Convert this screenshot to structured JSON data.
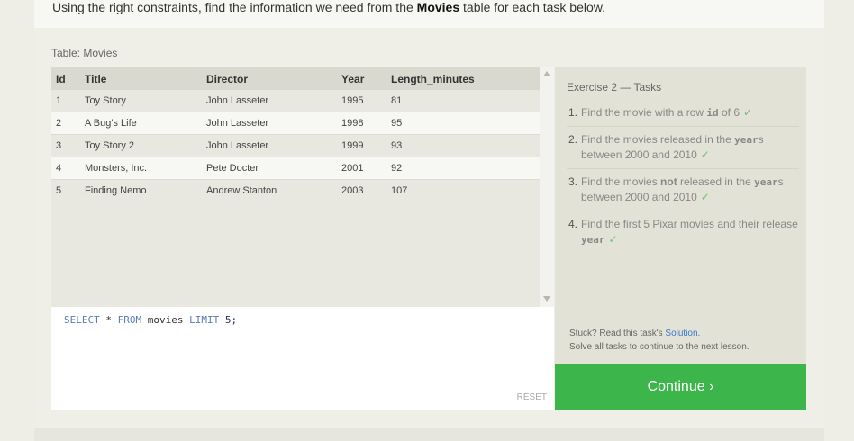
{
  "intro": {
    "before": "Using the right constraints, find the information we need from the ",
    "emphasis": "Movies",
    "after": " table for each task below."
  },
  "table": {
    "caption": "Table: Movies",
    "headers": [
      "Id",
      "Title",
      "Director",
      "Year",
      "Length_minutes"
    ],
    "rows": [
      [
        "1",
        "Toy Story",
        "John Lasseter",
        "1995",
        "81"
      ],
      [
        "2",
        "A Bug's Life",
        "John Lasseter",
        "1998",
        "95"
      ],
      [
        "3",
        "Toy Story 2",
        "John Lasseter",
        "1999",
        "93"
      ],
      [
        "4",
        "Monsters, Inc.",
        "Pete Docter",
        "2001",
        "92"
      ],
      [
        "5",
        "Finding Nemo",
        "Andrew Stanton",
        "2003",
        "107"
      ]
    ]
  },
  "editor": {
    "query_parts": [
      "SELECT",
      "*",
      "FROM",
      "movies",
      "LIMIT",
      "5;"
    ],
    "reset_label": "RESET"
  },
  "tasks": {
    "title": "Exercise 2 — Tasks",
    "items": [
      {
        "num": "1.",
        "text1": "Find the movie with a row ",
        "code": "id",
        "text2": " of 6"
      },
      {
        "num": "2.",
        "text1": "Find the movies released in the ",
        "code": "year",
        "text2": "s between 2000 and 2010"
      },
      {
        "num": "3.",
        "text1": "Find the movies ",
        "bold": "not",
        "text2": " released in the ",
        "code": "year",
        "text3": "s between 2000 and 2010"
      },
      {
        "num": "4.",
        "text1": "Find the first 5 Pixar movies and their release ",
        "code": "year",
        "text2": ""
      }
    ],
    "check": "✓"
  },
  "help": {
    "stuck_prefix": "Stuck? Read this task's ",
    "solution_link": "Solution",
    "stuck_suffix": ".",
    "solve_text": "Solve all tasks to continue to the next lesson."
  },
  "continue_label": "Continue ›",
  "colors": {
    "accent_green": "#3cb54a",
    "link_blue": "#3a78c9",
    "check_green": "#6cc46c"
  }
}
